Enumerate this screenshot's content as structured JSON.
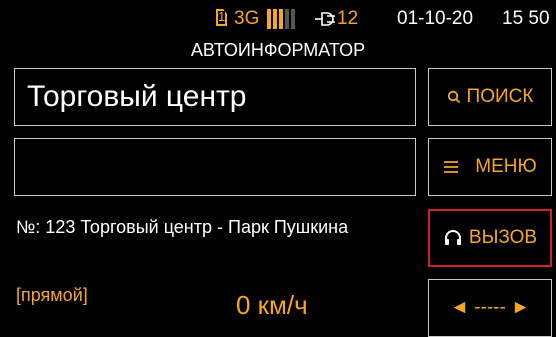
{
  "status": {
    "sim_slot": "1",
    "network": "3G",
    "battery_level": "12",
    "date": "01-10-20",
    "time": "15 50",
    "signal_bars_total": 5,
    "signal_bars_active": 3
  },
  "header": {
    "title": "АВТОИНФОРМАТОР"
  },
  "route": {
    "current_stop": "Торговый центр",
    "secondary": ""
  },
  "buttons": {
    "search_label": "ПОИСК",
    "menu_label": "МЕНЮ",
    "call_label": "ВЫЗОВ",
    "nav_label": "◄ ----- ►"
  },
  "trip": {
    "stop_line": "№: 123 Торговый центр - Парк Пушкина",
    "direction": "[прямой]",
    "speed": "0 км/ч"
  },
  "colors": {
    "accent": "#f5a623",
    "border": "#c8c8c8",
    "alert": "#d0202a",
    "background": "#000000"
  }
}
